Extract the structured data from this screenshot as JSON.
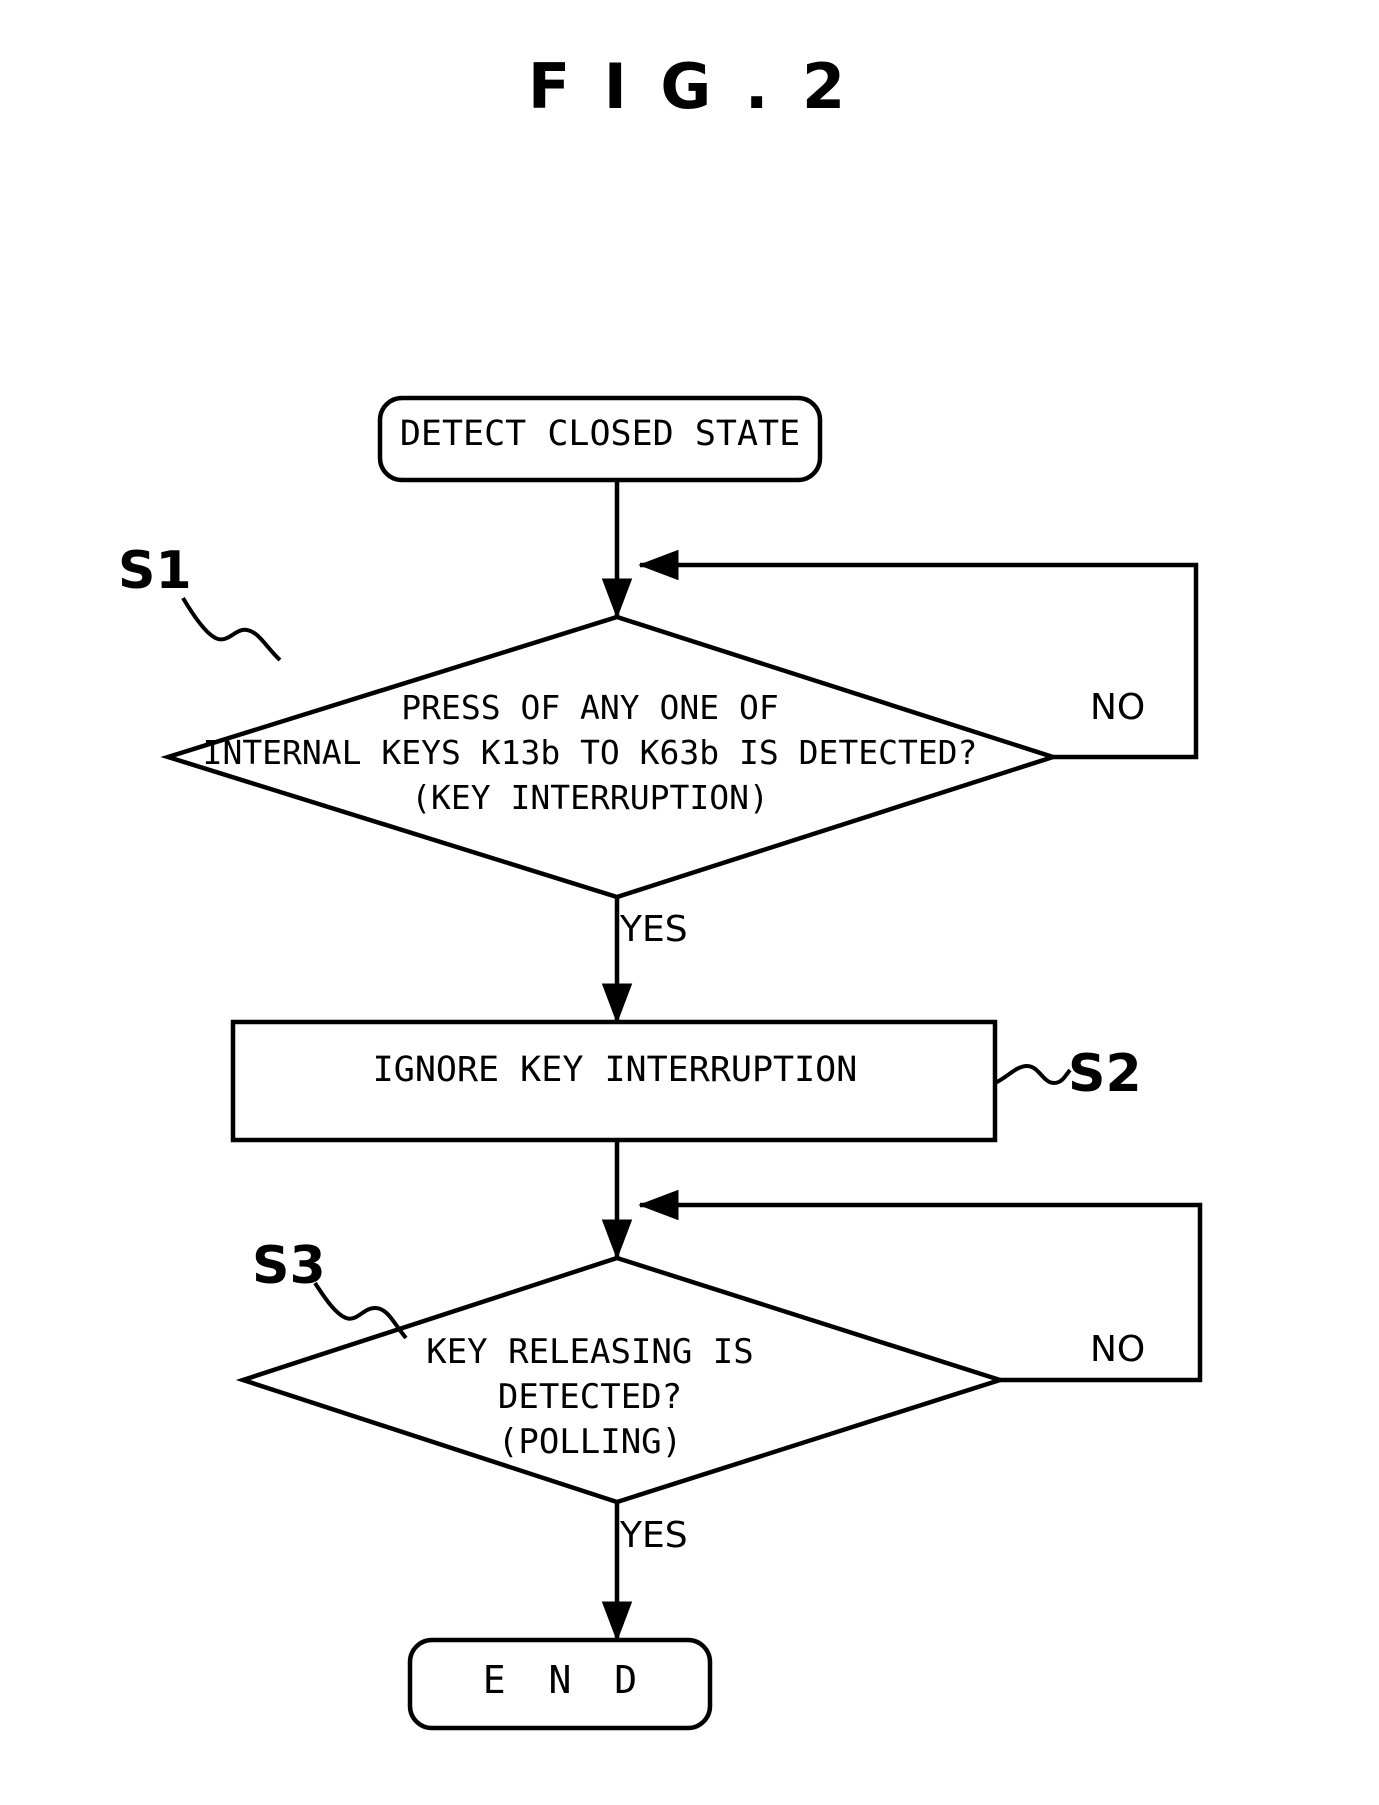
{
  "figure": {
    "title": "F I G . 2"
  },
  "nodes": {
    "start": {
      "label": "DETECT CLOSED STATE",
      "shape": "rounded-rectangle"
    },
    "decision1": {
      "label": "PRESS OF ANY ONE OF\nINTERNAL KEYS K13b TO K63b IS DETECTED?\n(KEY INTERRUPTION)",
      "shape": "diamond",
      "step_ref": "S1"
    },
    "process": {
      "label": "IGNORE KEY INTERRUPTION",
      "shape": "rectangle",
      "step_ref": "S2"
    },
    "decision2": {
      "label": "KEY RELEASING IS\nDETECTED?\n(POLLING)",
      "shape": "diamond",
      "step_ref": "S3"
    },
    "end": {
      "label": "E N D",
      "shape": "rounded-rectangle"
    }
  },
  "branches": {
    "decision1_no": "NO",
    "decision1_yes": "YES",
    "decision2_no": "NO",
    "decision2_yes": "YES"
  },
  "style": {
    "line_color": "#000000",
    "background": "#ffffff",
    "stroke_width": 4
  }
}
